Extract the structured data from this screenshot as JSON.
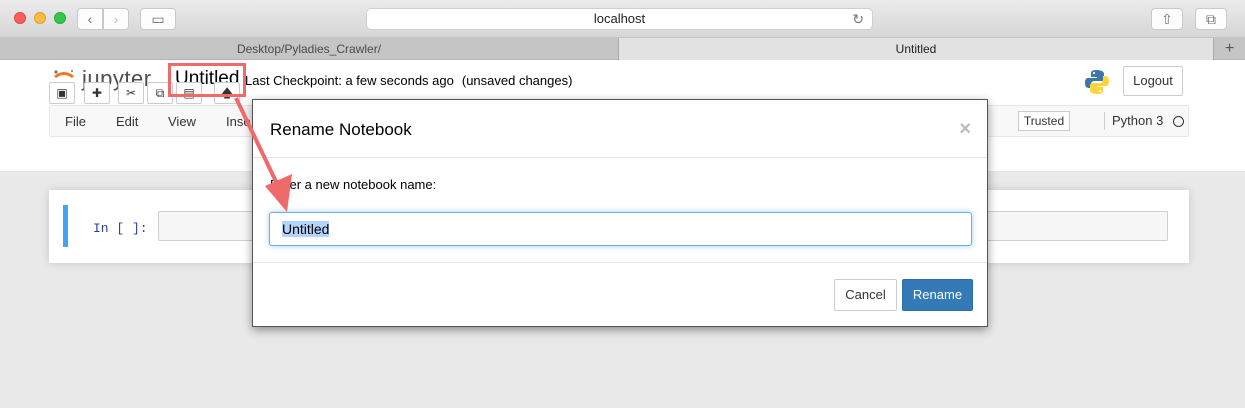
{
  "browser": {
    "url": "localhost",
    "tabs": [
      "Desktop/Pyladies_Crawler/",
      "Untitled"
    ],
    "new_tab_label": "+"
  },
  "jupyter": {
    "logo_text": "jupyter",
    "notebook_title": "Untitled",
    "checkpoint": "Last Checkpoint: a few seconds ago",
    "unsaved": "(unsaved changes)",
    "logout_label": "Logout",
    "menu": [
      "File",
      "Edit",
      "View",
      "Inse"
    ],
    "trusted_label": "Trusted",
    "kernel_name": "Python 3",
    "toolbar_icons": [
      "save-icon",
      "plus-icon",
      "cut-icon",
      "copy-icon",
      "paste-icon",
      "arrow-up-icon"
    ]
  },
  "cell": {
    "prompt": "In [ ]:"
  },
  "modal": {
    "title": "Rename Notebook",
    "close": "×",
    "label": "Enter a new notebook name:",
    "input_value": "Untitled",
    "cancel_label": "Cancel",
    "rename_label": "Rename"
  },
  "colors": {
    "accent": "#337ab7",
    "annotation": "#f0696b",
    "cell_active": "#42a5f5"
  }
}
